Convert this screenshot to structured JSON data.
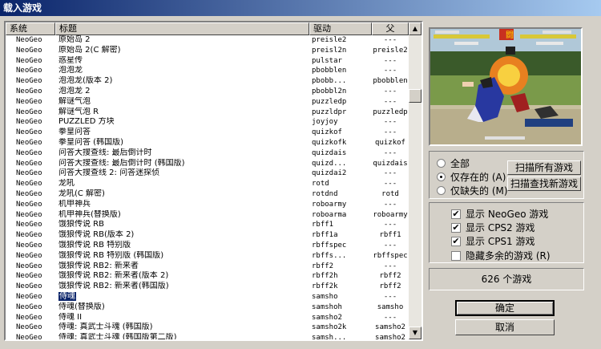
{
  "window": {
    "title": "载入游戏"
  },
  "list": {
    "headers": {
      "system": "系统",
      "title": "标题",
      "driver": "驱动",
      "parent": "父"
    },
    "rows": [
      {
        "system": "NeoGeo",
        "title": "原始岛 2",
        "driver": "preisle2",
        "parent": "---"
      },
      {
        "system": "NeoGeo",
        "title": "原始岛 2(C 解密)",
        "driver": "preisl2n",
        "parent": "preisle2"
      },
      {
        "system": "NeoGeo",
        "title": "惑星传",
        "driver": "pulstar",
        "parent": "---"
      },
      {
        "system": "NeoGeo",
        "title": "泡泡龙",
        "driver": "pbobblen",
        "parent": "---"
      },
      {
        "system": "NeoGeo",
        "title": "泡泡龙(版本 2)",
        "driver": "pbobb...",
        "parent": "pbobblen"
      },
      {
        "system": "NeoGeo",
        "title": "泡泡龙 2",
        "driver": "pbobbl2n",
        "parent": "---"
      },
      {
        "system": "NeoGeo",
        "title": "解谜气泡",
        "driver": "puzzledp",
        "parent": "---"
      },
      {
        "system": "NeoGeo",
        "title": "解谜气泡 R",
        "driver": "puzzldpr",
        "parent": "puzzledp"
      },
      {
        "system": "NeoGeo",
        "title": "PUZZLED 方块",
        "driver": "joyjoy",
        "parent": "---"
      },
      {
        "system": "NeoGeo",
        "title": "拳皇问答",
        "driver": "quizkof",
        "parent": "---"
      },
      {
        "system": "NeoGeo",
        "title": "拳皇问答 (韩国版)",
        "driver": "quizkofk",
        "parent": "quizkof"
      },
      {
        "system": "NeoGeo",
        "title": "问答大搜查线: 最后倒计时",
        "driver": "quizdais",
        "parent": "---"
      },
      {
        "system": "NeoGeo",
        "title": "问答大搜查线: 最后倒计时 (韩国版)",
        "driver": "quizd...",
        "parent": "quizdais"
      },
      {
        "system": "NeoGeo",
        "title": "问答大搜查线 2: 问答迷探侦",
        "driver": "quizdai2",
        "parent": "---"
      },
      {
        "system": "NeoGeo",
        "title": "龙吼",
        "driver": "rotd",
        "parent": "---"
      },
      {
        "system": "NeoGeo",
        "title": "龙吼(C 解密)",
        "driver": "rotdnd",
        "parent": "rotd"
      },
      {
        "system": "NeoGeo",
        "title": "机甲神兵",
        "driver": "roboarmy",
        "parent": "---"
      },
      {
        "system": "NeoGeo",
        "title": "机甲神兵(替换版)",
        "driver": "roboarma",
        "parent": "roboarmy"
      },
      {
        "system": "NeoGeo",
        "title": "饿狼传说 RB",
        "driver": "rbff1",
        "parent": "---"
      },
      {
        "system": "NeoGeo",
        "title": "饿狼传说 RB(版本 2)",
        "driver": "rbff1a",
        "parent": "rbff1"
      },
      {
        "system": "NeoGeo",
        "title": "饿狼传说 RB 特别版",
        "driver": "rbffspec",
        "parent": "---"
      },
      {
        "system": "NeoGeo",
        "title": "饿狼传说 RB 特别版 (韩国版)",
        "driver": "rbffs...",
        "parent": "rbffspec"
      },
      {
        "system": "NeoGeo",
        "title": "饿狼传说 RB2: 新来者",
        "driver": "rbff2",
        "parent": "---"
      },
      {
        "system": "NeoGeo",
        "title": "饿狼传说 RB2: 新来者(版本 2)",
        "driver": "rbff2h",
        "parent": "rbff2"
      },
      {
        "system": "NeoGeo",
        "title": "饿狼传说 RB2: 新来者(韩国版)",
        "driver": "rbff2k",
        "parent": "rbff2"
      },
      {
        "system": "NeoGeo",
        "title": "侍魂",
        "driver": "samsho",
        "parent": "---",
        "selected": true
      },
      {
        "system": "NeoGeo",
        "title": "侍魂(替换版)",
        "driver": "samshoh",
        "parent": "samsho"
      },
      {
        "system": "NeoGeo",
        "title": "侍魂 II",
        "driver": "samsho2",
        "parent": "---"
      },
      {
        "system": "NeoGeo",
        "title": "侍魂: 真武士斗魂 (韩国版)",
        "driver": "samsho2k",
        "parent": "samsho2"
      },
      {
        "system": "NeoGeo",
        "title": "侍魂: 真武士斗魂 (韩国版第二版)",
        "driver": "samsh...",
        "parent": "samsho2"
      }
    ]
  },
  "filter": {
    "options": [
      {
        "label": "全部",
        "selected": false
      },
      {
        "label": "仅存在的 (A)",
        "selected": true
      },
      {
        "label": "仅缺失的 (M)",
        "selected": false
      }
    ],
    "scan_all_label": "扫描所有游戏",
    "scan_new_label": "扫描查找新游戏"
  },
  "display": {
    "checks": [
      {
        "label": "显示 NeoGeo 游戏",
        "checked": true
      },
      {
        "label": "显示 CPS2 游戏",
        "checked": true
      },
      {
        "label": "显示 CPS1 游戏",
        "checked": true
      },
      {
        "label": "隐藏多余的游戏 (R)",
        "checked": false
      }
    ]
  },
  "count_text": "626 个游戏",
  "buttons": {
    "ok": "确定",
    "cancel": "取消"
  },
  "preview": {
    "kanji": "闘"
  }
}
